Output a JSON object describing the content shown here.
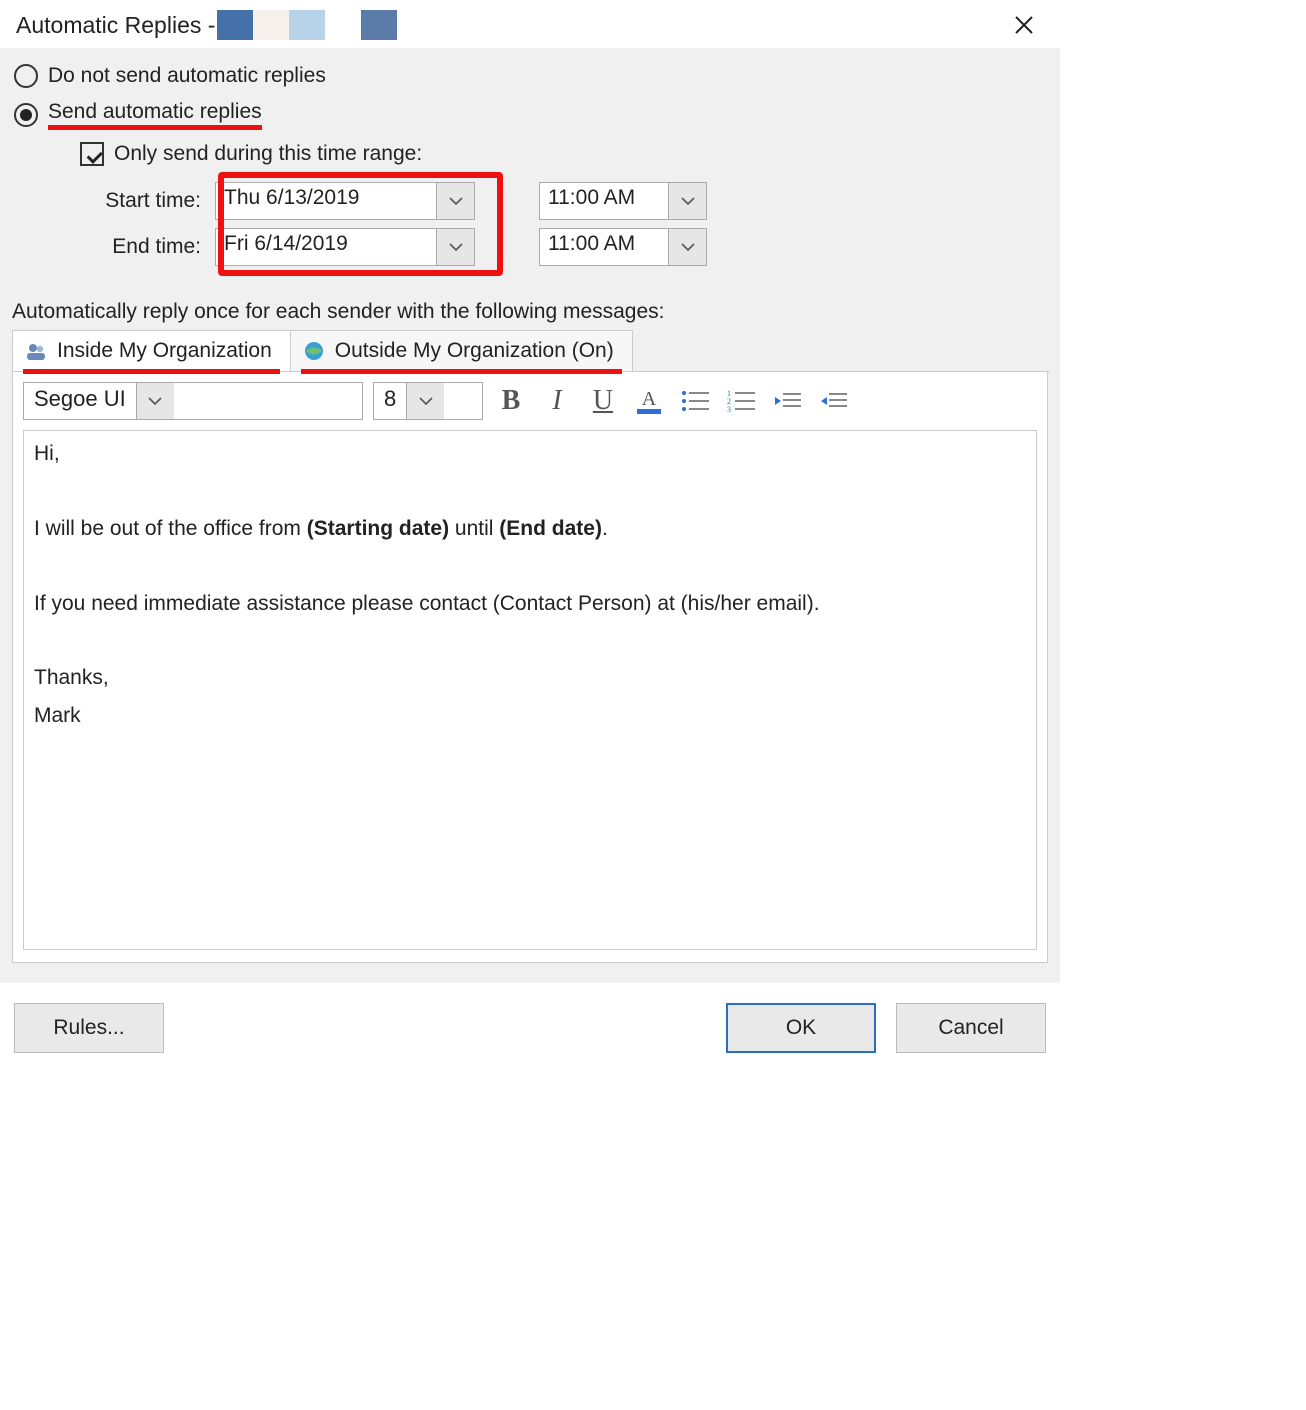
{
  "title": "Automatic Replies - ",
  "radios": {
    "do_not_send": "Do not send automatic replies",
    "send": "Send automatic replies"
  },
  "checkbox_label": "Only send during this time range:",
  "time": {
    "start_label": "Start time:",
    "end_label": "End time:",
    "start_date": "Thu 6/13/2019",
    "start_time": "11:00 AM",
    "end_date": "Fri 6/14/2019",
    "end_time": "11:00 AM"
  },
  "subtitle": "Automatically reply once for each sender with the following messages:",
  "tabs": {
    "inside": "Inside My Organization",
    "outside": "Outside My Organization (On)"
  },
  "toolbar": {
    "font": "Segoe UI",
    "size": "8"
  },
  "message": {
    "l1": "Hi,",
    "l2a": "I will be out of the office from ",
    "l2b": "(Starting date)",
    "l2c": " until ",
    "l2d": "(End date)",
    "l2e": ".",
    "l3": "If you need immediate assistance please contact (Contact Person) at (his/her email).",
    "l4": "Thanks,",
    "l5": "Mark"
  },
  "footer": {
    "rules": "Rules...",
    "ok": "OK",
    "cancel": "Cancel"
  }
}
